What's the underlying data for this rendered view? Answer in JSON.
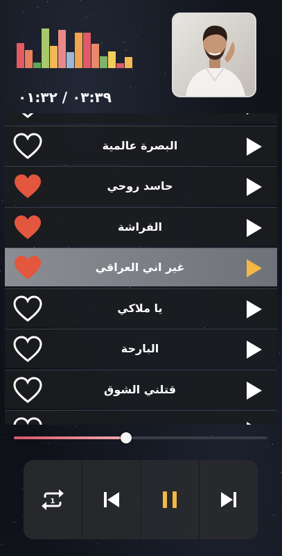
{
  "player": {
    "current_time": "٠١:٣٢",
    "separator": "/",
    "total_time": "٠٣:٣٩",
    "progress": 0.42
  },
  "visualizer": {
    "levels": [
      0.62,
      0.45,
      0.14,
      0.98,
      0.55,
      0.95,
      0.4,
      0.88,
      0.88,
      0.6,
      0.3,
      0.42,
      0.12,
      0.28
    ],
    "colors": [
      "#e35a62",
      "#e97f5e",
      "#5fa55a",
      "#a8c96b",
      "#f2b857",
      "#e98a88",
      "#9fb7d6",
      "#f0a44f",
      "#e05b67",
      "#e68a6b",
      "#7fb36b",
      "#f2cf5b",
      "#e05b67",
      "#f2b857"
    ]
  },
  "songs": [
    {
      "title": "",
      "favorite": false,
      "active": false
    },
    {
      "title": "البصرة عالمية",
      "favorite": false,
      "active": false
    },
    {
      "title": "حاسد روحي",
      "favorite": true,
      "active": false
    },
    {
      "title": "الفراشة",
      "favorite": true,
      "active": false
    },
    {
      "title": "غير اني العراقي",
      "favorite": true,
      "active": true
    },
    {
      "title": "يا ملاكي",
      "favorite": false,
      "active": false
    },
    {
      "title": "البارحة",
      "favorite": false,
      "active": false
    },
    {
      "title": "قتلني الشوق",
      "favorite": false,
      "active": false
    },
    {
      "title": "",
      "favorite": false,
      "active": false
    }
  ],
  "colors": {
    "heart_filled": "#e2573d",
    "play_active": "#f4b845",
    "play_default": "#ffffff",
    "pause": "#f4b845"
  },
  "icons": {
    "repeat": "repeat-one-icon",
    "previous": "skip-previous-icon",
    "pause": "pause-icon",
    "next": "skip-next-icon"
  }
}
